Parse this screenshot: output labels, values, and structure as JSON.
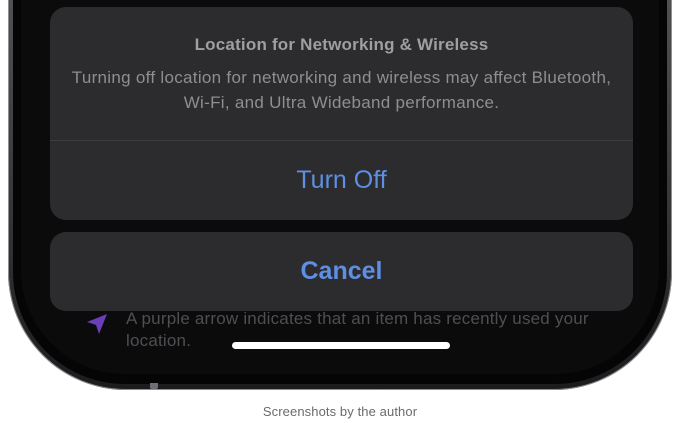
{
  "action_sheet": {
    "title": "Location for Networking & Wireless",
    "message": "Turning off location for networking and wireless may affect Bluetooth, Wi-Fi, and Ultra Wideband performance.",
    "confirm_label": "Turn Off",
    "cancel_label": "Cancel",
    "accent_color": "#5e8fe3"
  },
  "background": {
    "note": "A purple arrow indicates that an item has recently used your location.",
    "arrow_icon": "location-arrow-icon",
    "arrow_color": "#6a3fb8"
  },
  "caption": "Screenshots by the author"
}
